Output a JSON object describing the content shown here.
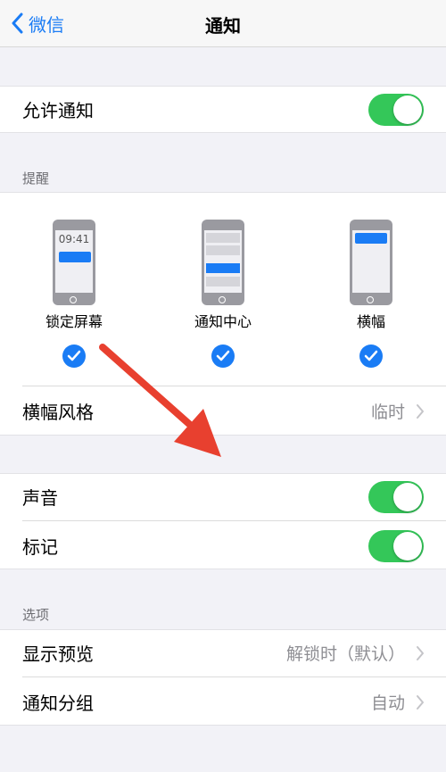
{
  "nav": {
    "back_label": "微信",
    "title": "通知"
  },
  "allow": {
    "label": "允许通知",
    "on": true
  },
  "alerts": {
    "header": "提醒",
    "styles": [
      {
        "caption": "锁定屏幕",
        "time": "09:41",
        "checked": true
      },
      {
        "caption": "通知中心",
        "checked": true
      },
      {
        "caption": "横幅",
        "checked": true
      }
    ],
    "banner_style": {
      "label": "横幅风格",
      "value": "临时"
    }
  },
  "sound": {
    "label": "声音",
    "on": true
  },
  "badges": {
    "label": "标记",
    "on": true
  },
  "options": {
    "header": "选项",
    "show_previews": {
      "label": "显示预览",
      "value": "解锁时（默认）"
    },
    "grouping": {
      "label": "通知分组",
      "value": "自动"
    }
  },
  "colors": {
    "accent": "#1a7cf5",
    "toggle_on": "#34c759",
    "annotation_arrow": "#e8402f"
  }
}
